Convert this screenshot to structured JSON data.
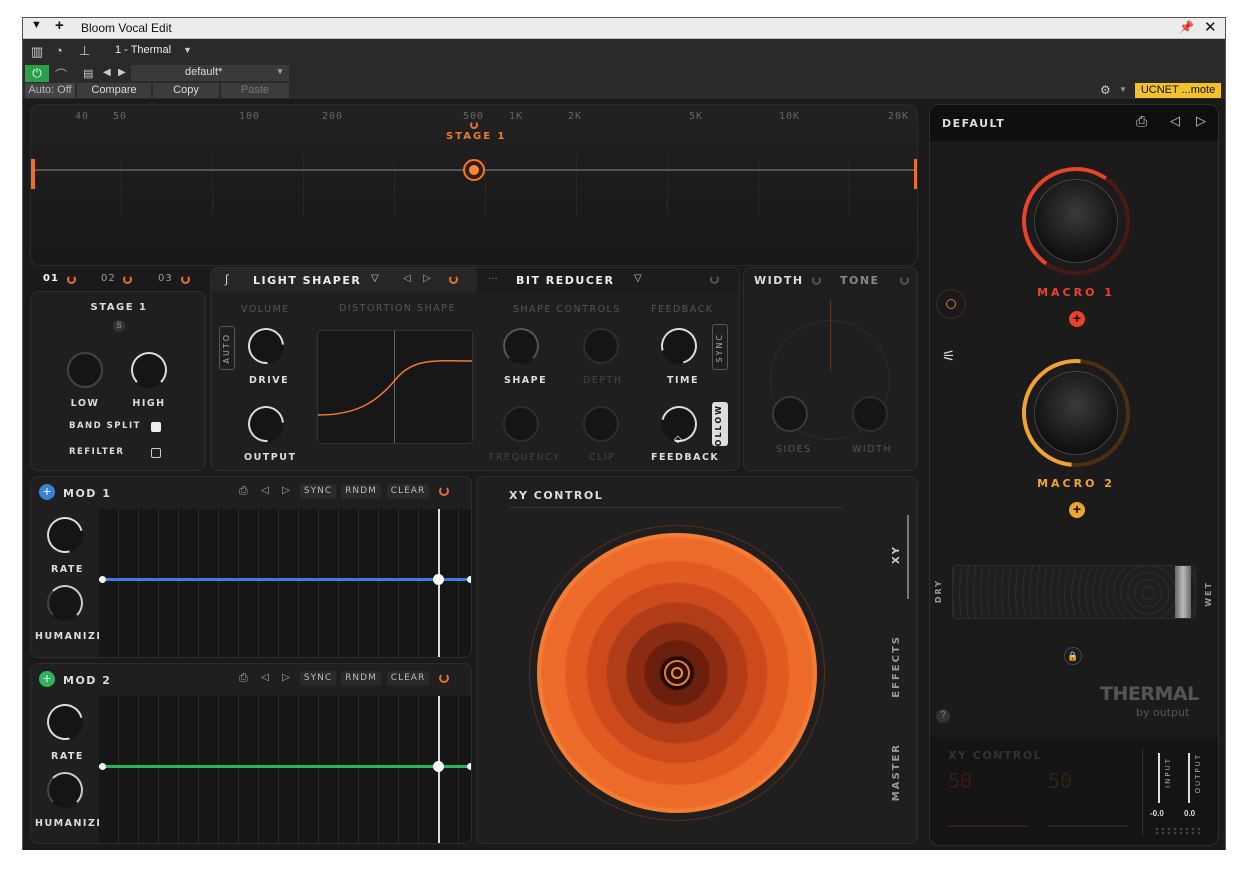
{
  "host": {
    "title": "Bloom Vocal Edit",
    "track": "1 - Thermal",
    "preset": "default*",
    "auto": "Auto: Off",
    "compare": "Compare",
    "copy": "Copy",
    "paste": "Paste",
    "ucnet": "UCNET ...mote"
  },
  "freq_ticks": [
    "40",
    "50",
    "100",
    "200",
    "500",
    "1K",
    "2K",
    "5K",
    "10K",
    "20K"
  ],
  "stage_label": "STAGE 1",
  "stage_tabs": [
    "01",
    "02",
    "03"
  ],
  "stage_panel": {
    "title": "STAGE 1",
    "solo": "S",
    "low": "LOW",
    "high": "HIGH",
    "band_split": "BAND SPLIT",
    "refilter": "REFILTER"
  },
  "fx1": {
    "name": "LIGHT SHAPER",
    "volume": "VOLUME",
    "dist": "DISTORTION SHAPE",
    "auto": "AUTO",
    "drive": "DRIVE",
    "output": "OUTPUT"
  },
  "fx2": {
    "name": "BIT REDUCER",
    "shape_controls": "SHAPE CONTROLS",
    "feedback_hdr": "FEEDBACK",
    "shape": "SHAPE",
    "depth": "DEPTH",
    "frequency": "FREQUENCY",
    "clip": "CLIP",
    "time": "TIME",
    "feedback": "FEEDBACK",
    "sync": "SYNC",
    "follow": "FOLLOW"
  },
  "width_panel": {
    "width": "WIDTH",
    "tone": "TONE",
    "sides": "SIDES",
    "width_knob": "WIDTH"
  },
  "mod1": {
    "title": "MOD 1",
    "sync": "SYNC",
    "rndm": "RNDM",
    "clear": "CLEAR",
    "rate": "RATE",
    "humanize": "HUMANIZE",
    "color": "#3b7fd6"
  },
  "mod2": {
    "title": "MOD 2",
    "sync": "SYNC",
    "rndm": "RNDM",
    "clear": "CLEAR",
    "rate": "RATE",
    "humanize": "HUMANIZE",
    "color": "#2fb35a"
  },
  "xy": {
    "title": "XY CONTROL",
    "tabs": [
      "XY",
      "EFFECTS",
      "MASTER"
    ]
  },
  "right": {
    "preset": "DEFAULT",
    "macro1": "MACRO 1",
    "macro2": "MACRO 2",
    "dry": "DRY",
    "wet": "WET",
    "brand": "THERMAL",
    "by": "by output",
    "xy_title": "XY CONTROL",
    "x_val": "50",
    "y_val": "50",
    "input": "INPUT",
    "output": "OUTPUT",
    "in_val": "-0.0",
    "out_val": "0.0"
  },
  "colors": {
    "accent": "#f07a2a",
    "macro1": "#e8442a",
    "macro2": "#f2a233"
  }
}
